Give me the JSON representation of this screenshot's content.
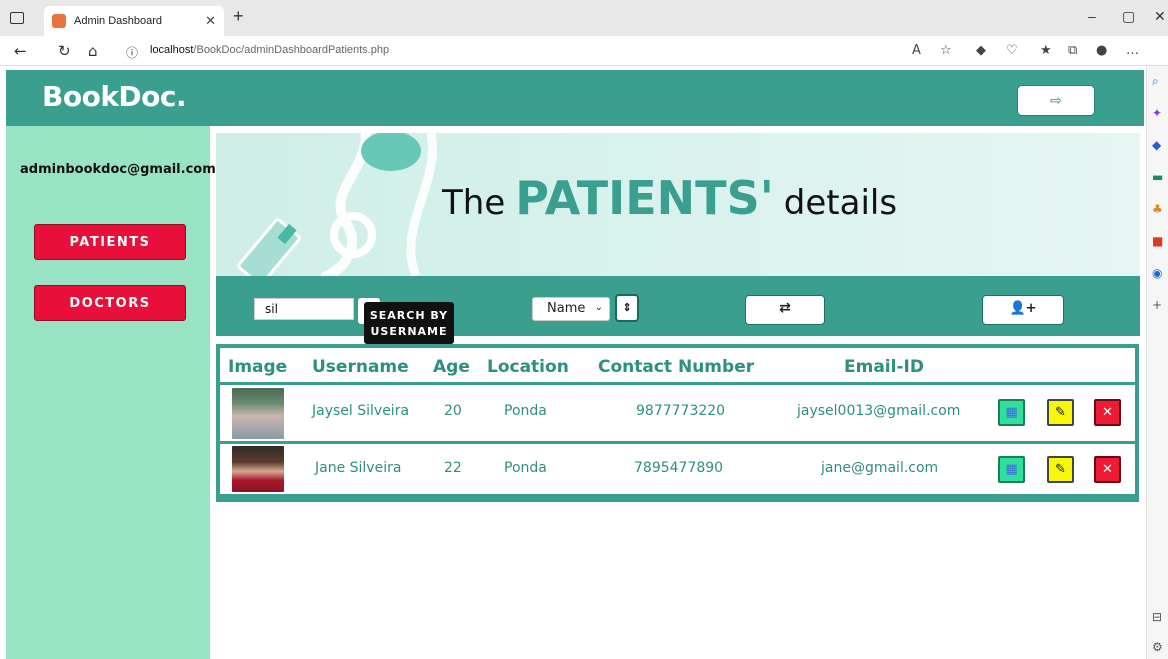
{
  "browser": {
    "tab_title": "Admin Dashboard",
    "url_host": "localhost",
    "url_path": "/BookDoc/adminDashboardPatients.php"
  },
  "header": {
    "brand": "BookDoc.",
    "logout_icon": "sign-out-icon"
  },
  "sidebar": {
    "admin_email": "adminbookdoc@gmail.com",
    "items": [
      {
        "label": "PATIENTS"
      },
      {
        "label": "DOCTORS"
      }
    ]
  },
  "banner": {
    "title_prefix": "The",
    "title_highlight": "PATIENTS'",
    "title_suffix": "details"
  },
  "toolbar": {
    "search_value": "sil",
    "search_tooltip_line1": "SEARCH BY",
    "search_tooltip_line2": "USERNAME",
    "sort_selected": "Name",
    "sort_order_icon": "sort-icon",
    "reset_icon": "exchange-icon",
    "add_icon": "user-plus-icon"
  },
  "table": {
    "columns": [
      "Image",
      "Username",
      "Age",
      "Location",
      "Contact Number",
      "Email-ID"
    ],
    "rows": [
      {
        "username": "Jaysel Silveira",
        "age": "20",
        "location": "Ponda",
        "contact": "9877773220",
        "email": "jaysel0013@gmail.com"
      },
      {
        "username": "Jane Silveira",
        "age": "22",
        "location": "Ponda",
        "contact": "7895477890",
        "email": "jane@gmail.com"
      }
    ]
  },
  "colors": {
    "primary": "#3a9f8f",
    "sidebar_bg": "#98e3c3",
    "danger": "#e8103a",
    "edit": "#f7f70a",
    "calendar": "#2fe09a"
  }
}
